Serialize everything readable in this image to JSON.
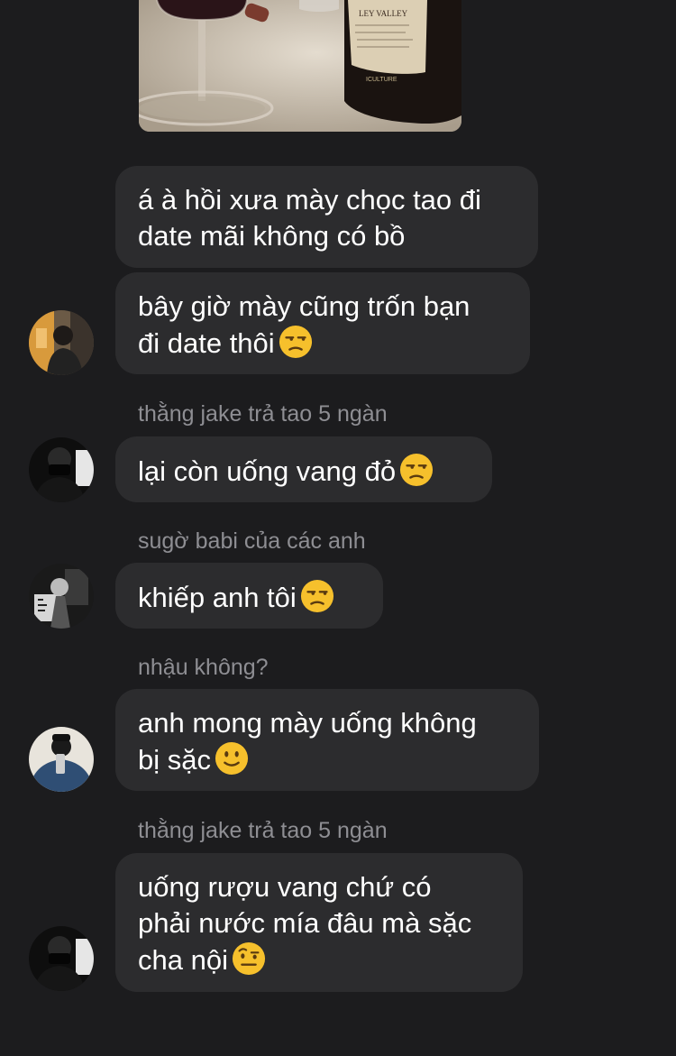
{
  "messages": [
    {
      "lines": [
        "á à hồi xưa mày chọc tao đi",
        "date mãi không có bồ"
      ],
      "emoji": ""
    },
    {
      "lines": [
        "bây giờ mày cũng trốn bạn",
        "đi date thôi"
      ],
      "emoji": "unamused-face"
    },
    {
      "sender": "thằng jake trả tao 5 ngàn",
      "lines": [
        "lại còn uống vang đỏ"
      ],
      "emoji": "unamused-face"
    },
    {
      "sender": "sugờ babi của các anh",
      "lines": [
        "khiếp anh tôi"
      ],
      "emoji": "unamused-face"
    },
    {
      "sender": "nhậu không?",
      "lines": [
        "anh mong mày uống không",
        "bị sặc"
      ],
      "emoji": "slightly-smiling-face"
    },
    {
      "sender": "thằng jake trả tao 5 ngàn",
      "lines": [
        "uống rượu vang chứ có",
        "phải nước mía đâu mà sặc",
        "cha nội"
      ],
      "emoji": "face-with-raised-eyebrow"
    }
  ],
  "colors": {
    "background": "#1c1c1e",
    "bubble": "#2c2c2e",
    "text": "#ffffff",
    "sender": "#8e8e93",
    "emoji": "#f6c02c"
  },
  "photo": {
    "label_lines": [
      "LEY VALLEY",
      "ICULTURE"
    ]
  }
}
